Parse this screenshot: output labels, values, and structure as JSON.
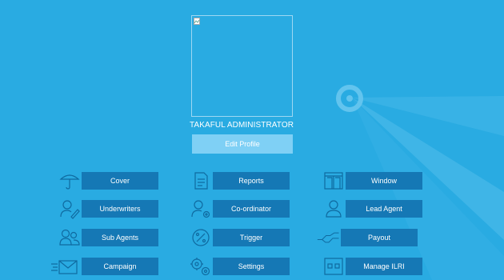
{
  "profile": {
    "name": "TAKAFUL ADMINISTRATOR",
    "edit_label": "Edit Profile"
  },
  "menu": {
    "cover": "Cover",
    "reports": "Reports",
    "window": "Window",
    "underwriters": "Underwriters",
    "coordinator": "Co-ordinator",
    "lead_agent": "Lead Agent",
    "sub_agents": "Sub Agents",
    "trigger": "Trigger",
    "payout": "Payout",
    "campaign": "Campaign",
    "settings": "Settings",
    "manage_ilri": "Manage ILRI"
  },
  "icons": {
    "cover": "umbrella-icon",
    "reports": "document-icon",
    "window": "window-icon",
    "underwriters": "user-pen-icon",
    "coordinator": "user-gear-icon",
    "lead_agent": "user-icon",
    "sub_agents": "users-icon",
    "trigger": "percent-icon",
    "payout": "handshake-icon",
    "campaign": "mail-icon",
    "settings": "gears-icon",
    "manage_ilri": "grid-icon"
  },
  "colors": {
    "background": "#29ABE2",
    "button": "#1578B5",
    "edit_button": "#7FD0F5"
  }
}
